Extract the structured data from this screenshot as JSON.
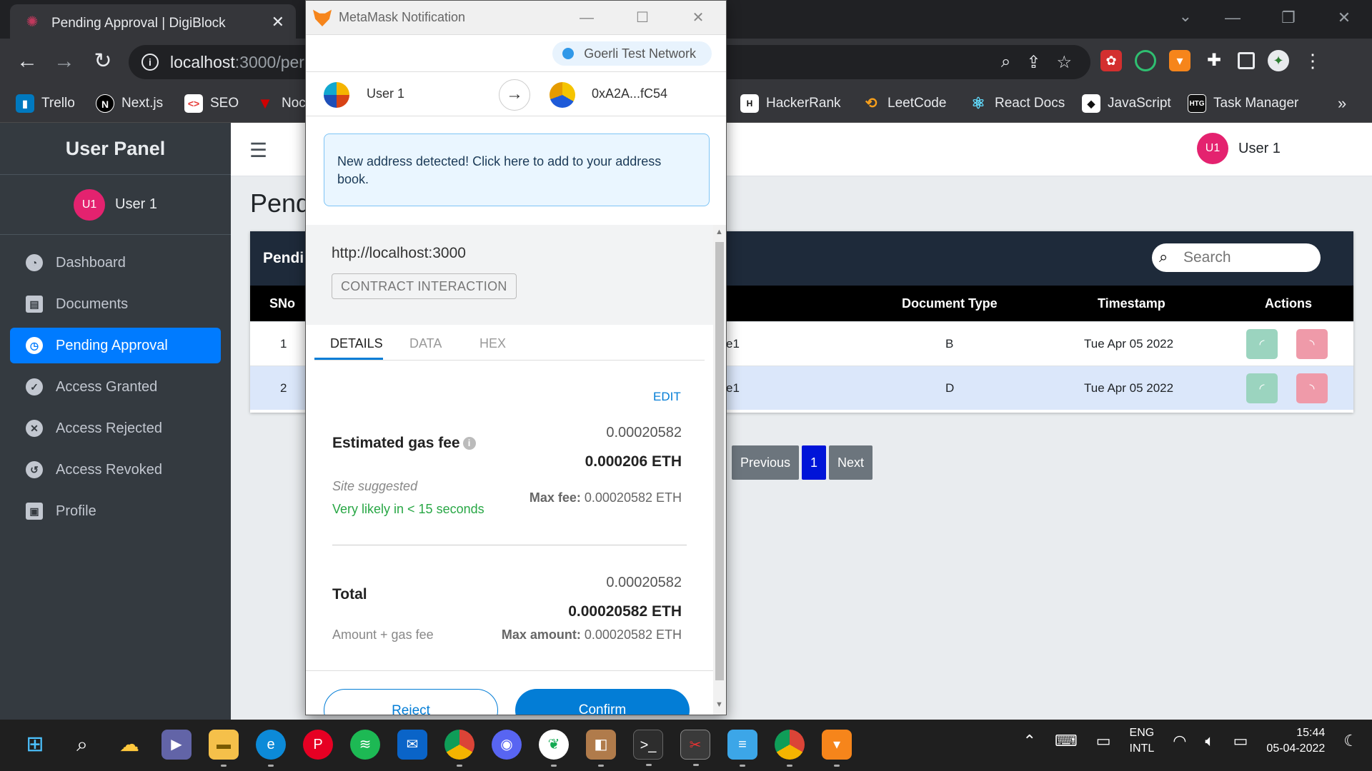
{
  "browser": {
    "tab_title": "Pending Approval | DigiBlock",
    "url_host": "localhost",
    "url_rest": ":3000/per",
    "bookmarks": [
      {
        "label": "Trello",
        "icon": "trello-icon",
        "color": "#0079bf",
        "glyph": "▮▮"
      },
      {
        "label": "Next.js",
        "icon": "nextjs-icon",
        "color": "#000000",
        "glyph": "N"
      },
      {
        "label": "SEO",
        "icon": "seo-icon",
        "color": "#ffffff",
        "glyph": "<>"
      },
      {
        "label": "Noc",
        "icon": "notion-icon",
        "color": "#d00000",
        "glyph": "▼"
      },
      {
        "label": "HackerRank",
        "icon": "hackerrank-icon",
        "color": "#111111",
        "glyph": "H"
      },
      {
        "label": "LeetCode",
        "icon": "leetcode-icon",
        "color": "#35363a",
        "glyph": "⟲"
      },
      {
        "label": "React Docs",
        "icon": "react-icon",
        "color": "#35363a",
        "glyph": "⚛"
      },
      {
        "label": "JavaScript",
        "icon": "javascript-icon",
        "color": "#111111",
        "glyph": "◆"
      },
      {
        "label": "Task Manager",
        "icon": "taskmanager-icon",
        "color": "#111111",
        "glyph": "HTG"
      }
    ]
  },
  "app": {
    "brand": "User Panel",
    "user_initials": "U1",
    "user_name": "User 1",
    "nav": [
      {
        "label": "Dashboard",
        "glyph": "◔",
        "active": false
      },
      {
        "label": "Documents",
        "glyph": "▤",
        "active": false
      },
      {
        "label": "Pending Approval",
        "glyph": "◷",
        "active": true
      },
      {
        "label": "Access Granted",
        "glyph": "✓",
        "active": false
      },
      {
        "label": "Access Rejected",
        "glyph": "✕",
        "active": false
      },
      {
        "label": "Access Revoked",
        "glyph": "↺",
        "active": false
      },
      {
        "label": "Profile",
        "glyph": "▣",
        "active": false
      }
    ],
    "page_title": "Pend",
    "card_title": "Pendi",
    "search_placeholder": "Search",
    "table": {
      "headers": {
        "sno": "SNo",
        "doc_type": "Document Type",
        "timestamp": "Timestamp",
        "actions": "Actions"
      },
      "rows": [
        {
          "sno": "1",
          "name": "e1",
          "doc_type": "B",
          "timestamp": "Tue Apr 05 2022"
        },
        {
          "sno": "2",
          "name": "e1",
          "doc_type": "D",
          "timestamp": "Tue Apr 05 2022"
        }
      ]
    },
    "pager": {
      "prev": "Previous",
      "current": "1",
      "next": "Next"
    }
  },
  "metamask": {
    "window_title": "MetaMask Notification",
    "network": "Goerli Test Network",
    "from_account": "User 1",
    "to_account": "0xA2A...fC54",
    "notice": "New address detected! Click here to add to your address book.",
    "origin": "http://localhost:3000",
    "interaction": "CONTRACT INTERACTION",
    "tabs": [
      "DETAILS",
      "DATA",
      "HEX"
    ],
    "edit": "EDIT",
    "gas_fee_top": "0.00020582",
    "gas_fee_label": "Estimated gas fee",
    "gas_fee_eth": "0.000206 ETH",
    "site_suggested": "Site suggested",
    "likely": "Very likely in < 15 seconds",
    "max_fee_label": "Max fee:",
    "max_fee_value": "0.00020582 ETH",
    "total_top": "0.00020582",
    "total_label": "Total",
    "total_eth": "0.00020582 ETH",
    "amount_label": "Amount + gas fee",
    "max_amount_label": "Max amount:",
    "max_amount_value": "0.00020582 ETH",
    "reject": "Reject",
    "confirm": "Confirm"
  },
  "taskbar": {
    "lang_line1": "ENG",
    "lang_line2": "INTL",
    "time": "15:44",
    "date": "05-04-2022"
  }
}
